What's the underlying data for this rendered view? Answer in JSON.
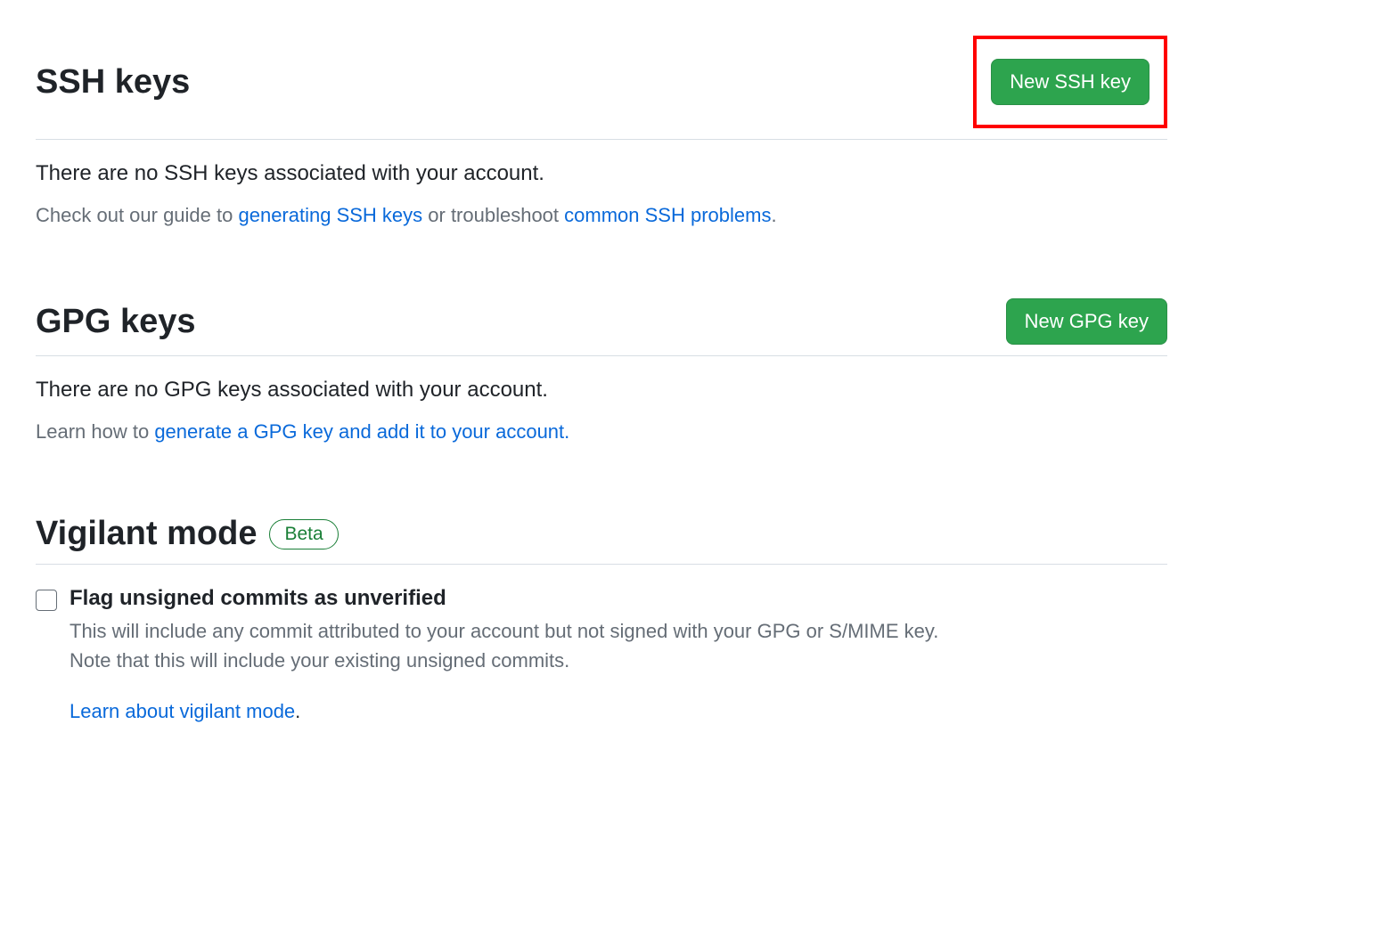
{
  "ssh": {
    "title": "SSH keys",
    "button": "New SSH key",
    "empty": "There are no SSH keys associated with your account.",
    "help_prefix": "Check out our guide to ",
    "help_link1": "generating SSH keys",
    "help_middle": " or troubleshoot ",
    "help_link2": "common SSH problems",
    "help_suffix": "."
  },
  "gpg": {
    "title": "GPG keys",
    "button": "New GPG key",
    "empty": "There are no GPG keys associated with your account.",
    "help_prefix": "Learn how to ",
    "help_link": "generate a GPG key and add it to your account.",
    "help_suffix": ""
  },
  "vigilant": {
    "title": "Vigilant mode",
    "badge": "Beta",
    "checkbox_label": "Flag unsigned commits as unverified",
    "desc_line1": "This will include any commit attributed to your account but not signed with your GPG or S/MIME key.",
    "desc_line2": "Note that this will include your existing unsigned commits.",
    "learn_link": "Learn about vigilant mode",
    "learn_suffix": "."
  }
}
